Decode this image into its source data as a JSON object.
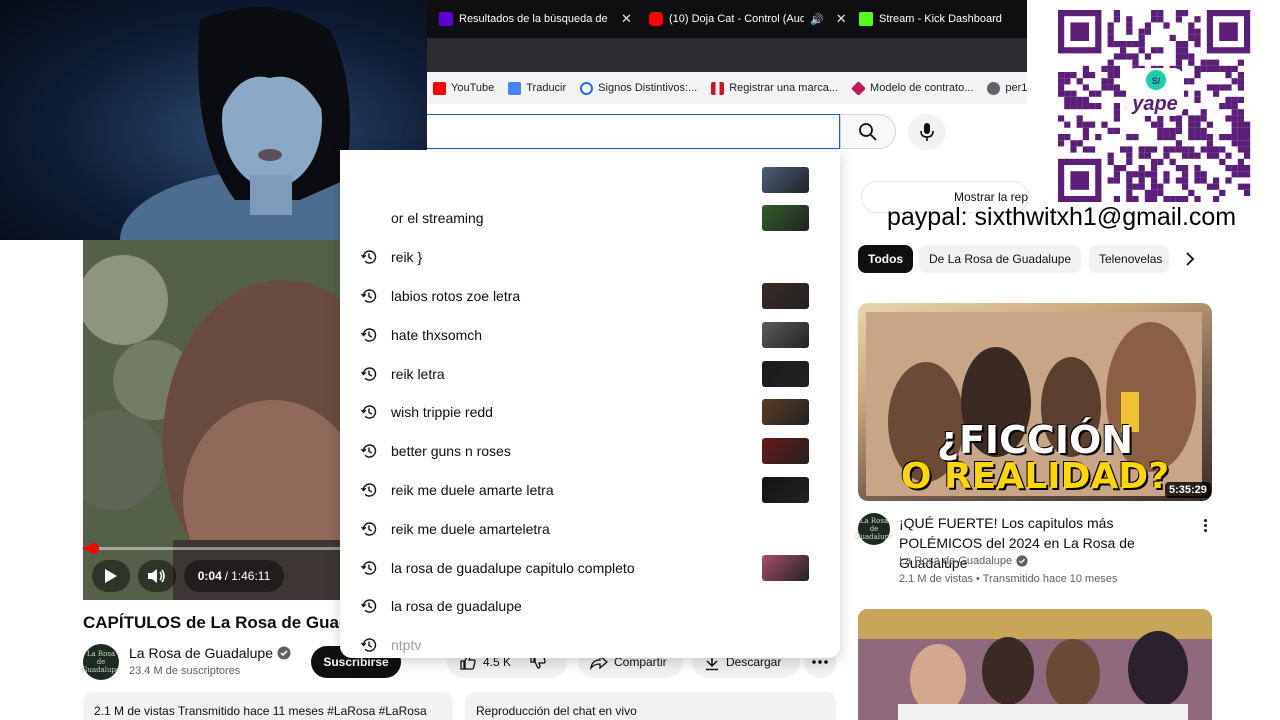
{
  "tabs": [
    {
      "title": "Resultados de la búsqueda de i",
      "color": "#6001d2",
      "close": "✕"
    },
    {
      "title": "(10) Doja Cat - Control (Aud",
      "color": "#ff0000",
      "close": "✕"
    },
    {
      "title": "Stream - Kick Dashboard",
      "color": "#53fc18"
    }
  ],
  "bookmarks": [
    {
      "label": "YouTube",
      "color": "#ff0000"
    },
    {
      "label": "Traducir",
      "color": "#4285f4"
    },
    {
      "label": "Signos Distintivos:...",
      "color": "#1a73e8"
    },
    {
      "label": "Registrar una marca...",
      "color": "#d91023"
    },
    {
      "label": "Modelo de contrato...",
      "color": "#c2185b"
    },
    {
      "label": "per1",
      "color": "#5f6368"
    }
  ],
  "search": {
    "placeholder": ""
  },
  "suggestions": [
    {
      "text": "",
      "thumb": "#4a5f7a"
    },
    {
      "text": "or el streaming",
      "thumb": "#2f5d2a"
    },
    {
      "text": "reik }",
      "thumb": ""
    },
    {
      "text": "labios rotos zoe letra",
      "thumb": "#3a2a26"
    },
    {
      "text": "hate thxsomch",
      "thumb": "#5c5c5c"
    },
    {
      "text": "reik letra",
      "thumb": "#1a1a1a"
    },
    {
      "text": "wish trippie redd",
      "thumb": "#5a3b24"
    },
    {
      "text": "better guns n roses",
      "thumb": "#6b1818"
    },
    {
      "text": "reik me duele amarte letra",
      "thumb": "#141414"
    },
    {
      "text": "reik me duele amarteletra",
      "thumb": ""
    },
    {
      "text": "la rosa de guadalupe capitulo completo",
      "thumb": "#a84d6d"
    },
    {
      "text": "la rosa de guadalupe",
      "thumb": ""
    },
    {
      "text": "ntptv",
      "thumb": ""
    }
  ],
  "player": {
    "current": "0:04",
    "separator": "/",
    "duration": "1:46:11",
    "progress": 0.0006
  },
  "video": {
    "title": "CAPÍTULOS de La Rosa de Guadalupe",
    "channel": "La Rosa de Guadalupe",
    "subscribers": "23.4 M de suscriptores",
    "subscribe_label": "Suscribirse",
    "avatar_text": "La Rosa de Guadalupe",
    "likes": "4.5 K",
    "share_label": "Compartir",
    "download_label": "Descargar",
    "description": "2.1 M de vistas  Transmitido hace 11 meses  #LaRosa #LaRosa",
    "chat_label": "Reproducción del chat en vivo"
  },
  "sidebar": {
    "show_chat": "Mostrar la repetición del chat",
    "chips": [
      "Todos",
      "De La Rosa de Guadalupe",
      "Telenovelas"
    ],
    "rec1": {
      "title": "¡QUÉ FUERTE! Los capitulos más POLÉMICOS del 2024 en La Rosa de Guadalupe",
      "channel": "La Rosa de Guadalupe",
      "meta": "2.1 M de vistas • Transmitido hace 10 meses",
      "duration": "5:35:29",
      "overlay_line1": "¿FICCIÓN",
      "overlay_line2": "O REALIDAD?"
    },
    "avatar_text": "La Rosa de Guadalupe"
  },
  "overlay": {
    "paypal": "paypal: sixthwitxh1@gmail.com",
    "qr_brand": "yape",
    "qr_badge": "S/"
  },
  "colors": {
    "accent": "#ff0000",
    "search_border": "#1c62b9",
    "chip_active": "#0f0f0f"
  }
}
